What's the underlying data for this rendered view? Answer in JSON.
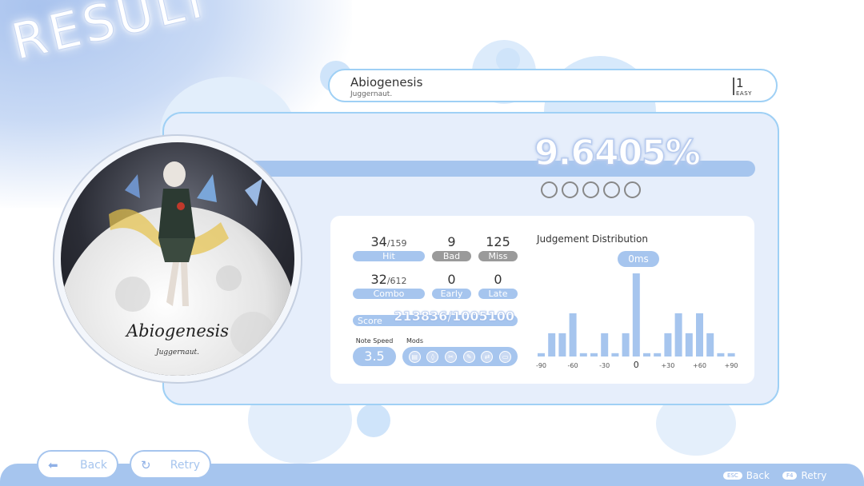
{
  "screen": {
    "title": "RESULT"
  },
  "song": {
    "title": "Abiogenesis",
    "artist": "Juggernaut.",
    "level": "1",
    "difficulty": "EASY"
  },
  "accuracy": {
    "value": "9.6405%",
    "progress": 0.096,
    "rank_slots": 5
  },
  "jacket": {
    "title": "Abiogenesis",
    "artist": "Juggernaut."
  },
  "stats": {
    "hit": {
      "value": "34",
      "total": "/159",
      "label": "Hit"
    },
    "bad": {
      "value": "9",
      "label": "Bad"
    },
    "miss": {
      "value": "125",
      "label": "Miss"
    },
    "combo": {
      "value": "32",
      "total": "/612",
      "label": "Combo"
    },
    "early": {
      "value": "0",
      "label": "Early"
    },
    "late": {
      "value": "0",
      "label": "Late"
    },
    "score": {
      "label": "Score",
      "value": "213836/1005100"
    },
    "note_speed": {
      "label": "Note Speed",
      "value": "3.5"
    },
    "mods": {
      "label": "Mods",
      "icons": [
        "film-icon",
        "shield-icon",
        "scissors-icon",
        "pencil-icon",
        "swap-icon",
        "monitor-icon"
      ]
    }
  },
  "distribution": {
    "title": "Judgement Distribution",
    "badge": "0ms",
    "tick_labels": [
      "-90",
      "-60",
      "-30",
      "0",
      "+30",
      "+60",
      "+90"
    ],
    "chart_data": {
      "type": "bar",
      "x": [
        -90,
        -80,
        -70,
        -60,
        -50,
        -40,
        -30,
        -20,
        -10,
        0,
        10,
        20,
        30,
        40,
        50,
        60,
        70,
        80,
        90
      ],
      "values": [
        1,
        7,
        7,
        13,
        1,
        1,
        7,
        1,
        7,
        25,
        1,
        1,
        7,
        13,
        7,
        13,
        7,
        1,
        1
      ],
      "xlabel": "",
      "ylabel": "",
      "grid": false
    }
  },
  "buttons": {
    "back": "Back",
    "retry": "Retry"
  },
  "hints": {
    "back_key": "ESC",
    "back_label": "Back",
    "retry_key": "F4",
    "retry_label": "Retry"
  },
  "colors": {
    "accent": "#a6c5ee",
    "border": "#9fd0f5",
    "panel": "#e6eefb",
    "grey_pill": "#9a9a9a"
  }
}
